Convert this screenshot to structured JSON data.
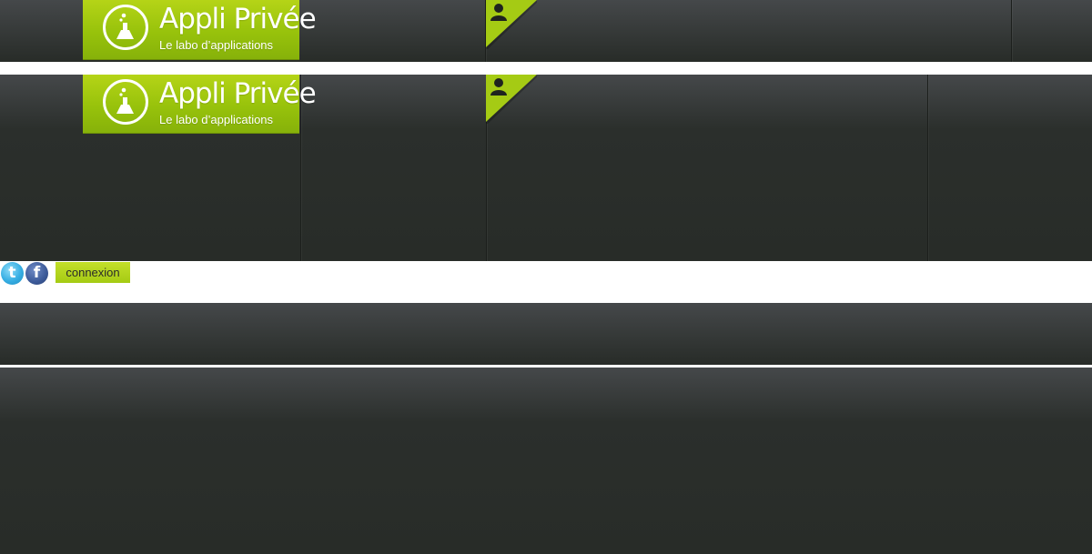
{
  "brand": {
    "title": "Appli Privée",
    "subtitle": "Le labo d’applications",
    "accent_color": "#a5cb14",
    "logo_icon": "flask-info-icon"
  },
  "header": {
    "user_icon": "user-icon"
  },
  "toolbar": {
    "twitter_icon": "twitter-icon",
    "facebook_icon": "facebook-icon",
    "twitter_glyph": "t",
    "facebook_glyph": "f",
    "login_label": "connexion"
  }
}
